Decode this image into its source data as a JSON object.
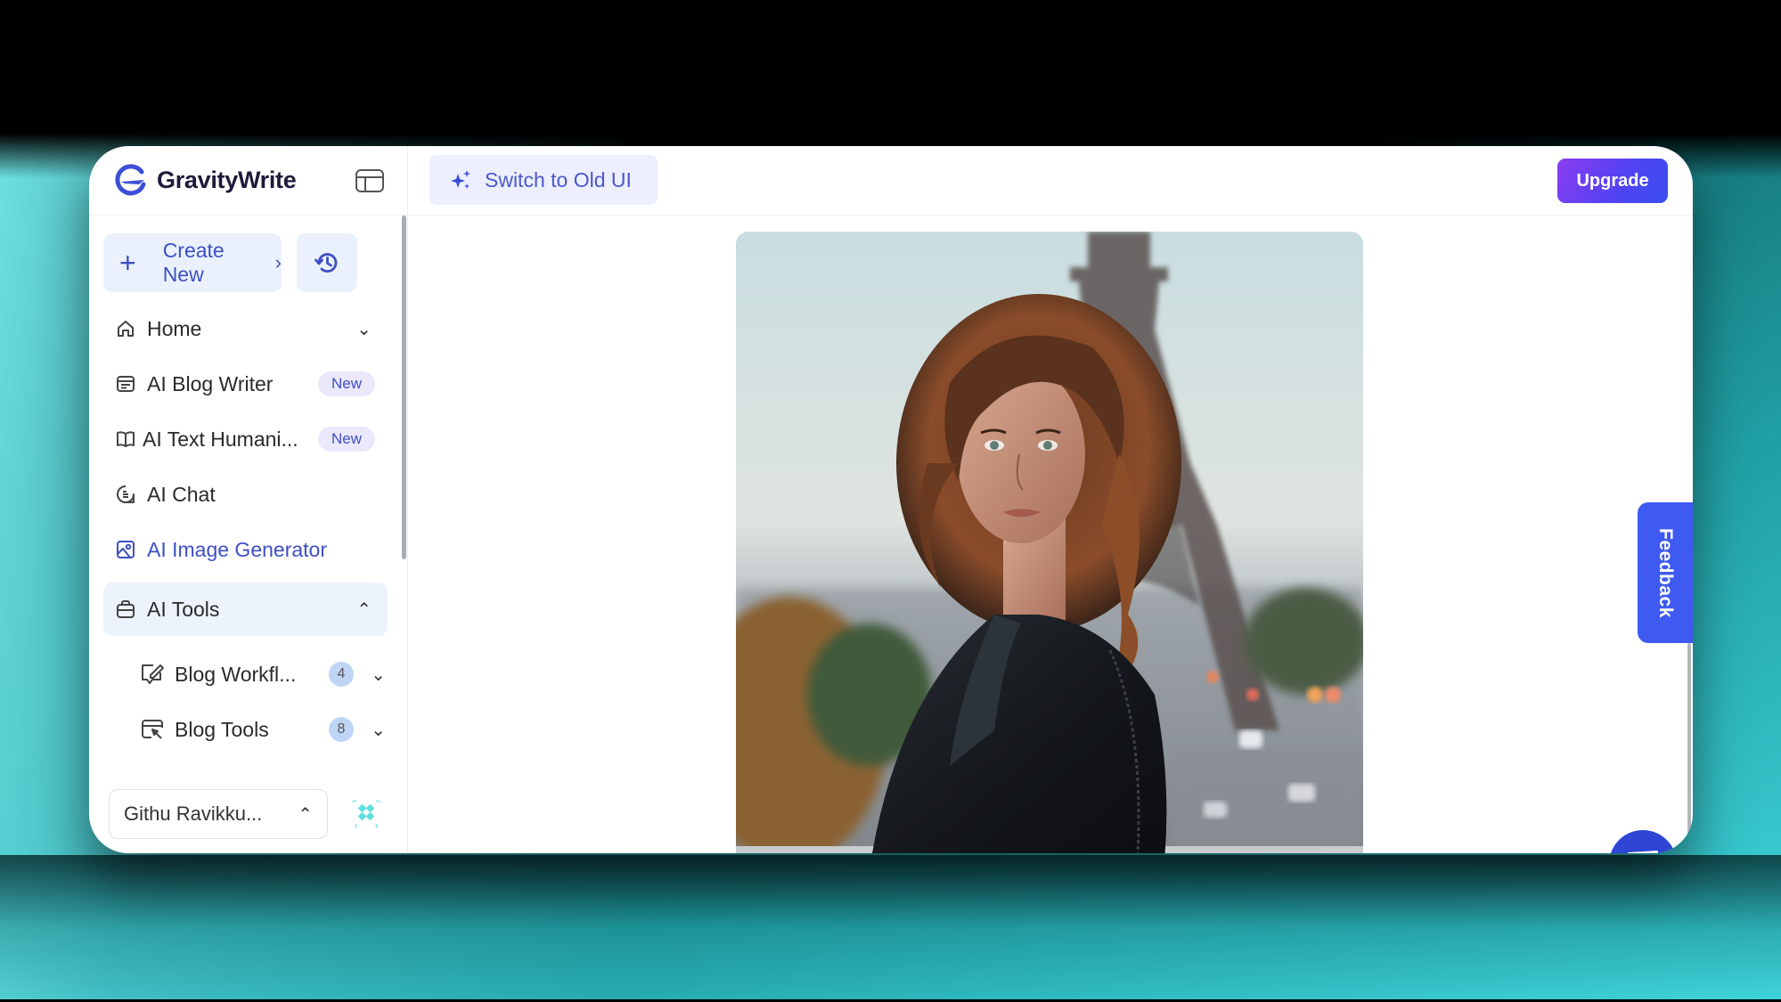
{
  "app": {
    "name": "GravityWrite",
    "brand_color": "#3d4fc4",
    "upgrade_gradient": [
      "#8a3cf0",
      "#3b4ef0"
    ],
    "feedback_color": "#3f5af0",
    "chat_color": "#2f45d6"
  },
  "sidebar": {
    "create_new_label": "Create New",
    "nav": [
      {
        "label": "Home",
        "icon": "home-icon",
        "chevron": "down"
      },
      {
        "label": "AI Blog Writer",
        "icon": "blog-writer-icon",
        "badge": "New"
      },
      {
        "label": "AI Text Humani...",
        "icon": "book-icon",
        "badge": "New"
      },
      {
        "label": "AI Chat",
        "icon": "chat-bubble-icon"
      },
      {
        "label": "AI Image Generator",
        "icon": "image-icon",
        "active": true
      },
      {
        "label": "AI Tools",
        "icon": "toolbox-icon",
        "chevron": "up",
        "expanded": true
      }
    ],
    "sub_items": [
      {
        "label": "Blog Workfl...",
        "icon": "edit-message-icon",
        "count": "4"
      },
      {
        "label": "Blog Tools",
        "icon": "browser-edit-icon",
        "count": "8"
      }
    ],
    "user": {
      "name": "Githu Ravikku..."
    }
  },
  "topbar": {
    "switch_label": "Switch to Old UI",
    "upgrade_label": "Upgrade"
  },
  "content": {
    "image_alt": "Woman with curly hair in black leather jacket in front of the Eiffel Tower"
  },
  "feedback": {
    "label": "Feedback"
  }
}
